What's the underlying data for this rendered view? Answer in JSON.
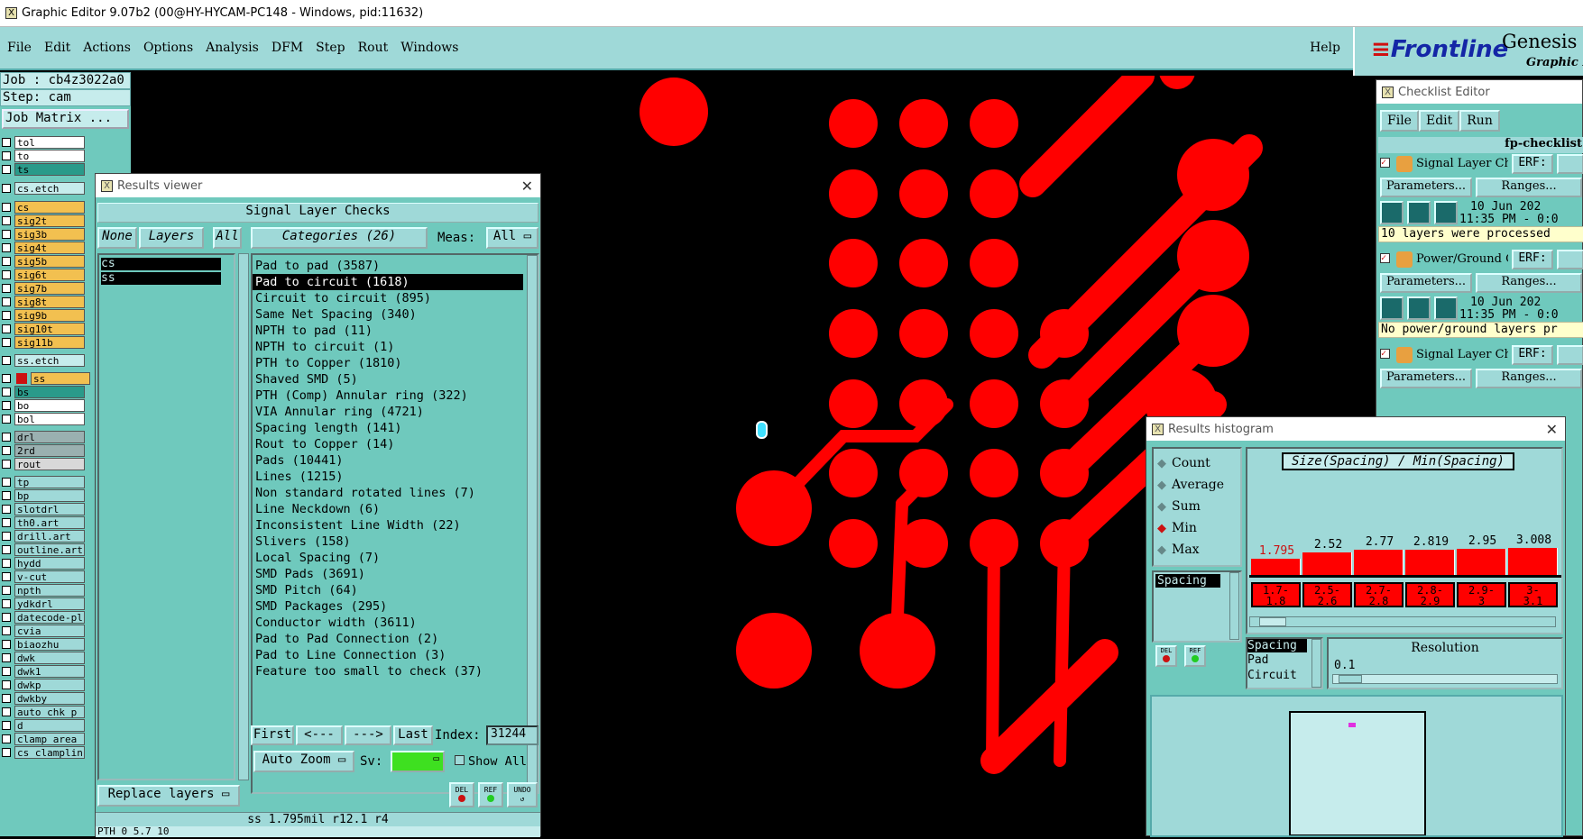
{
  "window": {
    "title": "Graphic Editor 9.07b2 (00@HY-HYCAM-PC148 - Windows, pid:11632)"
  },
  "menu": [
    "File",
    "Edit",
    "Actions",
    "Options",
    "Analysis",
    "DFM",
    "Step",
    "Rout",
    "Windows"
  ],
  "help": "Help",
  "logo": {
    "brand": "Frontline",
    "product": "Genesis",
    "sub": "Graphic Editor"
  },
  "left": {
    "job": "Job : cb4z3022a0",
    "step": "Step: cam",
    "matrix": "Job Matrix ...",
    "layers": [
      {
        "n": "tol",
        "c": "#ffffff"
      },
      {
        "n": "to",
        "c": "#ffffff"
      },
      {
        "n": "ts",
        "c": "#2a9a8a"
      },
      {
        "n": "cs.etch",
        "c": "#c6ecec"
      },
      {
        "n": "cs",
        "c": "#f2c050"
      },
      {
        "n": "sig2t",
        "c": "#f2c050"
      },
      {
        "n": "sig3b",
        "c": "#f2c050"
      },
      {
        "n": "sig4t",
        "c": "#f2c050"
      },
      {
        "n": "sig5b",
        "c": "#f2c050"
      },
      {
        "n": "sig6t",
        "c": "#f2c050"
      },
      {
        "n": "sig7b",
        "c": "#f2c050"
      },
      {
        "n": "sig8t",
        "c": "#f2c050"
      },
      {
        "n": "sig9b",
        "c": "#f2c050"
      },
      {
        "n": "sig10t",
        "c": "#f2c050"
      },
      {
        "n": "sig11b",
        "c": "#f2c050"
      },
      {
        "n": "ss.etch",
        "c": "#c6ecec"
      },
      {
        "n": "ss",
        "c": "#f2c050"
      },
      {
        "n": "bs",
        "c": "#2a9a8a"
      },
      {
        "n": "bo",
        "c": "#ffffff"
      },
      {
        "n": "bol",
        "c": "#ffffff"
      },
      {
        "n": "drl",
        "c": "#9ab0b0"
      },
      {
        "n": "2rd",
        "c": "#9ab0b0"
      },
      {
        "n": "rout",
        "c": "#d8d8d8"
      },
      {
        "n": "tp",
        "c": "#9fd9d8"
      },
      {
        "n": "bp",
        "c": "#9fd9d8"
      },
      {
        "n": "slotdrl",
        "c": "#9fd9d8"
      },
      {
        "n": "th0.art",
        "c": "#9fd9d8"
      },
      {
        "n": "drill.art",
        "c": "#9fd9d8"
      },
      {
        "n": "outline.art",
        "c": "#9fd9d8"
      },
      {
        "n": "hydd",
        "c": "#9fd9d8"
      },
      {
        "n": "v-cut",
        "c": "#9fd9d8"
      },
      {
        "n": "npth",
        "c": "#9fd9d8"
      },
      {
        "n": "ydkdrl",
        "c": "#9fd9d8"
      },
      {
        "n": "datecode-pl",
        "c": "#9fd9d8"
      },
      {
        "n": "cvia",
        "c": "#9fd9d8"
      },
      {
        "n": "biaozhu",
        "c": "#9fd9d8"
      },
      {
        "n": "dwk",
        "c": "#9fd9d8"
      },
      {
        "n": "dwk1",
        "c": "#9fd9d8"
      },
      {
        "n": "dwkp",
        "c": "#9fd9d8"
      },
      {
        "n": "dwkby",
        "c": "#9fd9d8"
      },
      {
        "n": "auto_chk_p",
        "c": "#9fd9d8"
      },
      {
        "n": "d",
        "c": "#9fd9d8"
      },
      {
        "n": "clamp_area",
        "c": "#9fd9d8"
      },
      {
        "n": "cs_clamplin",
        "c": "#9fd9d8"
      }
    ]
  },
  "results": {
    "title": "Results viewer",
    "group": "Signal Layer Checks",
    "none": "None",
    "layers": "Layers",
    "all": "All",
    "categories_btn": "Categories (26)",
    "meas_label": "Meas:",
    "meas_value": "All",
    "layer_list": [
      "cs",
      "ss"
    ],
    "categories": [
      "Pad to pad (3587)",
      "Pad to circuit (1618)",
      "Circuit to circuit (895)",
      "Same Net Spacing (340)",
      "NPTH to pad (11)",
      "NPTH to circuit (1)",
      "PTH to Copper (1810)",
      "Shaved SMD (5)",
      "PTH (Comp) Annular ring (322)",
      "VIA Annular ring (4721)",
      "Spacing length (141)",
      "Rout to Copper (14)",
      "Pads (10441)",
      "Lines (1215)",
      "Non standard rotated lines (7)",
      "Line Neckdown (6)",
      "Inconsistent Line Width (22)",
      "Slivers (158)",
      "Local Spacing (7)",
      "SMD Pads (3691)",
      "SMD Pitch (64)",
      "SMD Packages (295)",
      "Conductor width (3611)",
      "Pad to Pad Connection (2)",
      "Pad to Line Connection (3)",
      "Feature too small to check (37)"
    ],
    "first": "First",
    "prev": "<---",
    "next": "--->",
    "last": "Last",
    "index_label": "Index:",
    "index_value": "31244",
    "autozoom": "Auto Zoom",
    "sv": "Sv:",
    "showall": "Show All",
    "replace": "Replace layers",
    "del": "DEL",
    "ref": "REF",
    "undo": "UNDO",
    "status": "ss 1.795mil  r12.1  r4",
    "status2": "PTH    0   5.7 10"
  },
  "checklist": {
    "title": "Checklist Editor",
    "menu": [
      "File",
      "Edit",
      "Run"
    ],
    "name": "fp-checklist",
    "items": [
      {
        "label": "Signal Layer Ch",
        "erf": "ERF:",
        "date": "10 Jun 202",
        "time": "11:35 PM - 0:0",
        "msg": "10 layers were processed"
      },
      {
        "label": "Power/Ground C",
        "erf": "ERF:",
        "date": "10 Jun 202",
        "time": "11:35 PM - 0:0",
        "msg": "No power/ground layers pr"
      },
      {
        "label": "Signal Layer Ch",
        "erf": "ERF:"
      }
    ],
    "params": "Parameters...",
    "ranges": "Ranges..."
  },
  "histogram": {
    "title": "Results histogram",
    "modes": [
      "Count",
      "Average",
      "Sum",
      "Min",
      "Max"
    ],
    "selected_mode": "Min",
    "list_item": "Spacing",
    "chart_title": "Size(Spacing) / Min(Spacing)",
    "bars": [
      {
        "v": "1.795",
        "r1": "1.7-",
        "r2": "1.8"
      },
      {
        "v": "2.52",
        "r1": "2.5-",
        "r2": "2.6"
      },
      {
        "v": "2.77",
        "r1": "2.7-",
        "r2": "2.8"
      },
      {
        "v": "2.819",
        "r1": "2.8-",
        "r2": "2.9"
      },
      {
        "v": "2.95",
        "r1": "2.9-",
        "r2": "3"
      },
      {
        "v": "3.008",
        "r1": "3-",
        "r2": "3.1"
      }
    ],
    "types": [
      "Spacing",
      "Pad",
      "Circuit"
    ],
    "resolution_label": "Resolution",
    "resolution_value": "0.1",
    "del": "DEL",
    "ref": "REF"
  }
}
